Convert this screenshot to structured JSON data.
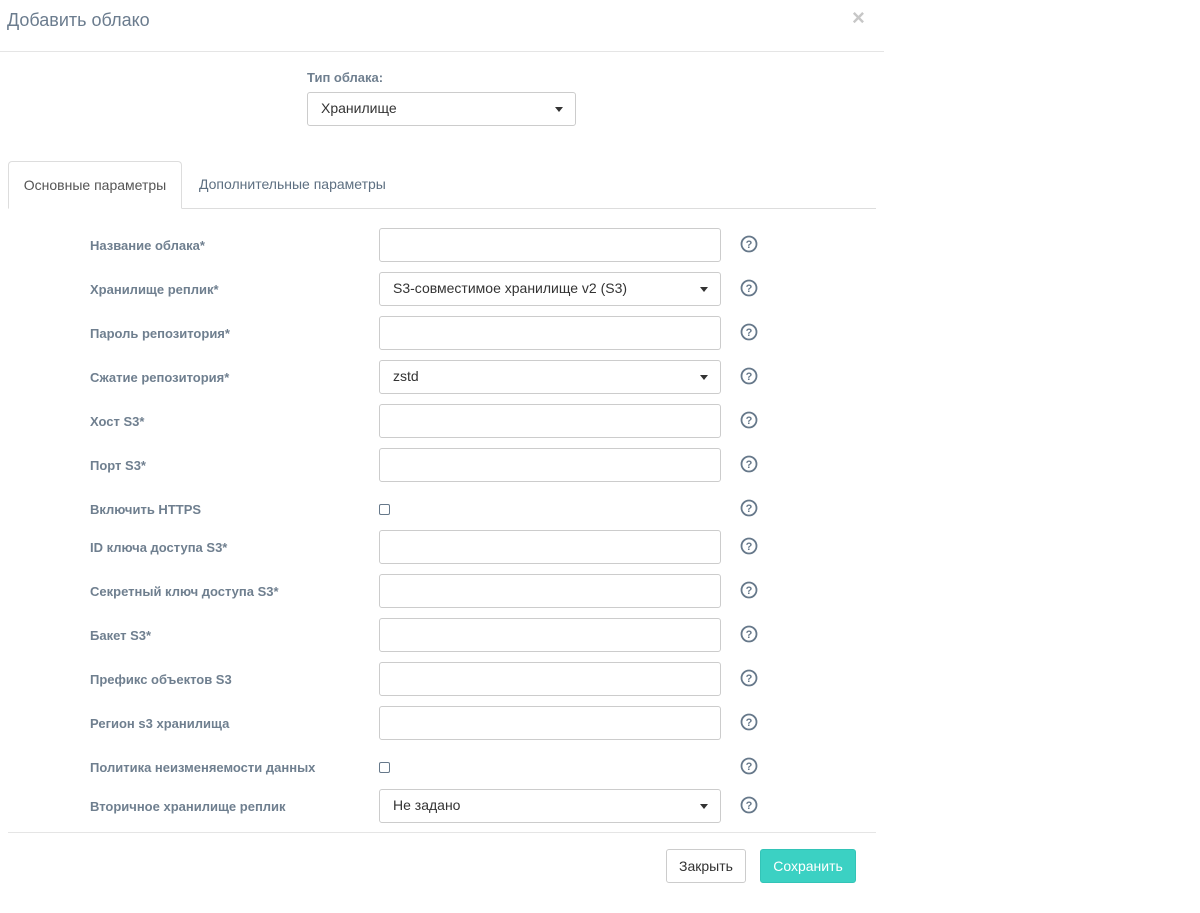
{
  "modal": {
    "title": "Добавить облако"
  },
  "cloud_type": {
    "label": "Тип облака:",
    "value": "Хранилище"
  },
  "tabs": [
    {
      "label": "Основные параметры",
      "active": true
    },
    {
      "label": "Дополнительные параметры",
      "active": false
    }
  ],
  "fields": {
    "cloud_name": {
      "label": "Название облака*",
      "value": ""
    },
    "replica_storage": {
      "label": "Хранилище реплик*",
      "value": "S3-совместимое хранилище v2 (S3)"
    },
    "repo_password": {
      "label": "Пароль репозитория*",
      "value": ""
    },
    "repo_compression": {
      "label": "Сжатие репозитория*",
      "value": "zstd"
    },
    "s3_host": {
      "label": "Хост S3*",
      "value": ""
    },
    "s3_port": {
      "label": "Порт S3*",
      "value": ""
    },
    "enable_https": {
      "label": "Включить HTTPS",
      "checked": false
    },
    "s3_access_key_id": {
      "label": "ID ключа доступа S3*",
      "value": ""
    },
    "s3_secret_key": {
      "label": "Секретный ключ доступа S3*",
      "value": ""
    },
    "s3_bucket": {
      "label": "Бакет S3*",
      "value": ""
    },
    "s3_prefix": {
      "label": "Префикс объектов S3",
      "value": ""
    },
    "s3_region": {
      "label": "Регион s3 хранилища",
      "value": ""
    },
    "immutability_policy": {
      "label": "Политика неизменяемости данных",
      "checked": false
    },
    "secondary_replica_storage": {
      "label": "Вторичное хранилище реплик",
      "value": "Не задано"
    }
  },
  "footer": {
    "close_label": "Закрыть",
    "save_label": "Сохранить"
  },
  "colors": {
    "accent": "#3bd1c3",
    "label": "#6f7f8f",
    "help_icon": "#66788a"
  },
  "icons": {
    "close": "close-icon",
    "help": "help-icon",
    "caret": "caret-down-icon"
  }
}
